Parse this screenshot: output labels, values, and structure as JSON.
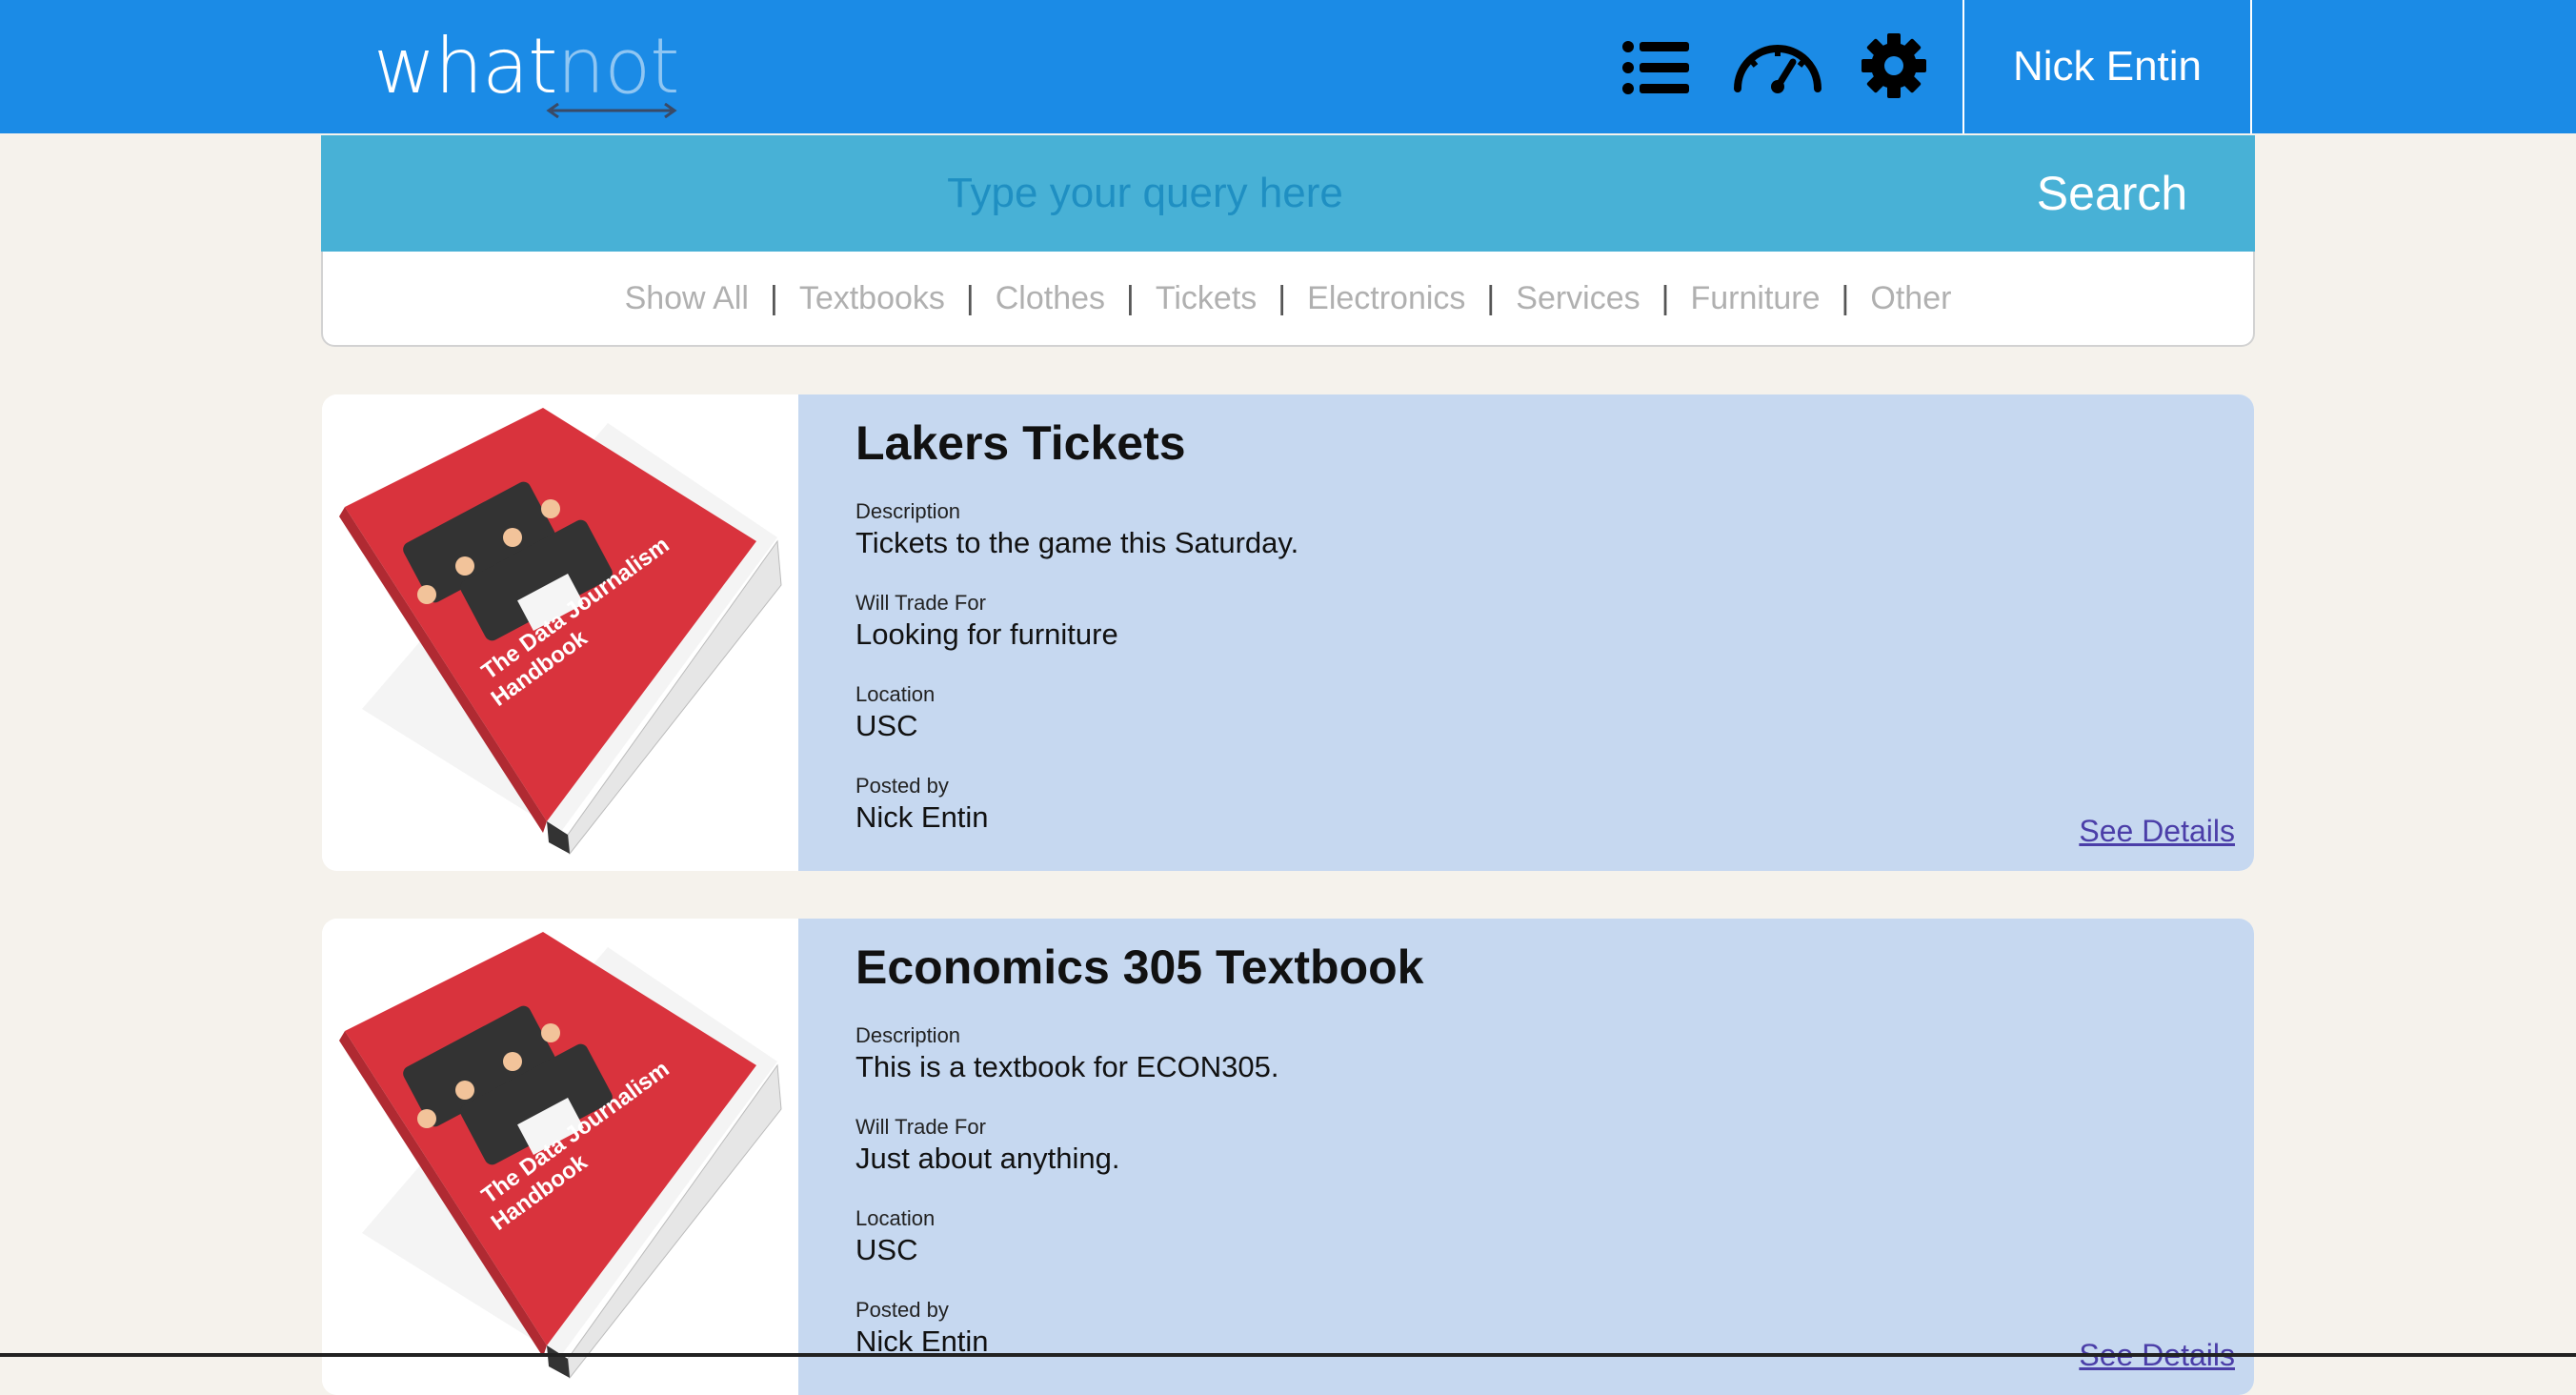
{
  "app": {
    "logo_part1": "what",
    "logo_part2": "not",
    "user_name": "Nick Entin"
  },
  "nav": {
    "icons": [
      "list-icon",
      "dashboard-gauge-icon",
      "settings-gear-icon"
    ]
  },
  "search": {
    "placeholder": "Type your query here",
    "button_label": "Search"
  },
  "categories": [
    "Show All",
    "Textbooks",
    "Clothes",
    "Tickets",
    "Electronics",
    "Services",
    "Furniture",
    "Other"
  ],
  "listings": [
    {
      "title": "Lakers Tickets",
      "description_label": "Description",
      "description": "Tickets to the game this Saturday.",
      "trade_label": "Will Trade For",
      "trade": "Looking for furniture",
      "location_label": "Location",
      "location": "USC",
      "posted_label": "Posted by",
      "posted_by": "Nick Entin",
      "details_label": "See Details"
    },
    {
      "title": "Economics 305 Textbook",
      "description_label": "Description",
      "description": "This is a textbook for ECON305.",
      "trade_label": "Will Trade For",
      "trade": "Just about anything.",
      "location_label": "Location",
      "location": "USC",
      "posted_label": "Posted by",
      "posted_by": "Nick Entin",
      "details_label": "See Details"
    }
  ],
  "colors": {
    "header": "#1b8be6",
    "search_bar": "#48b1d6",
    "card_body": "#c6d8f0",
    "page_bg": "#f5f2ec",
    "book_cover": "#d9333d"
  }
}
